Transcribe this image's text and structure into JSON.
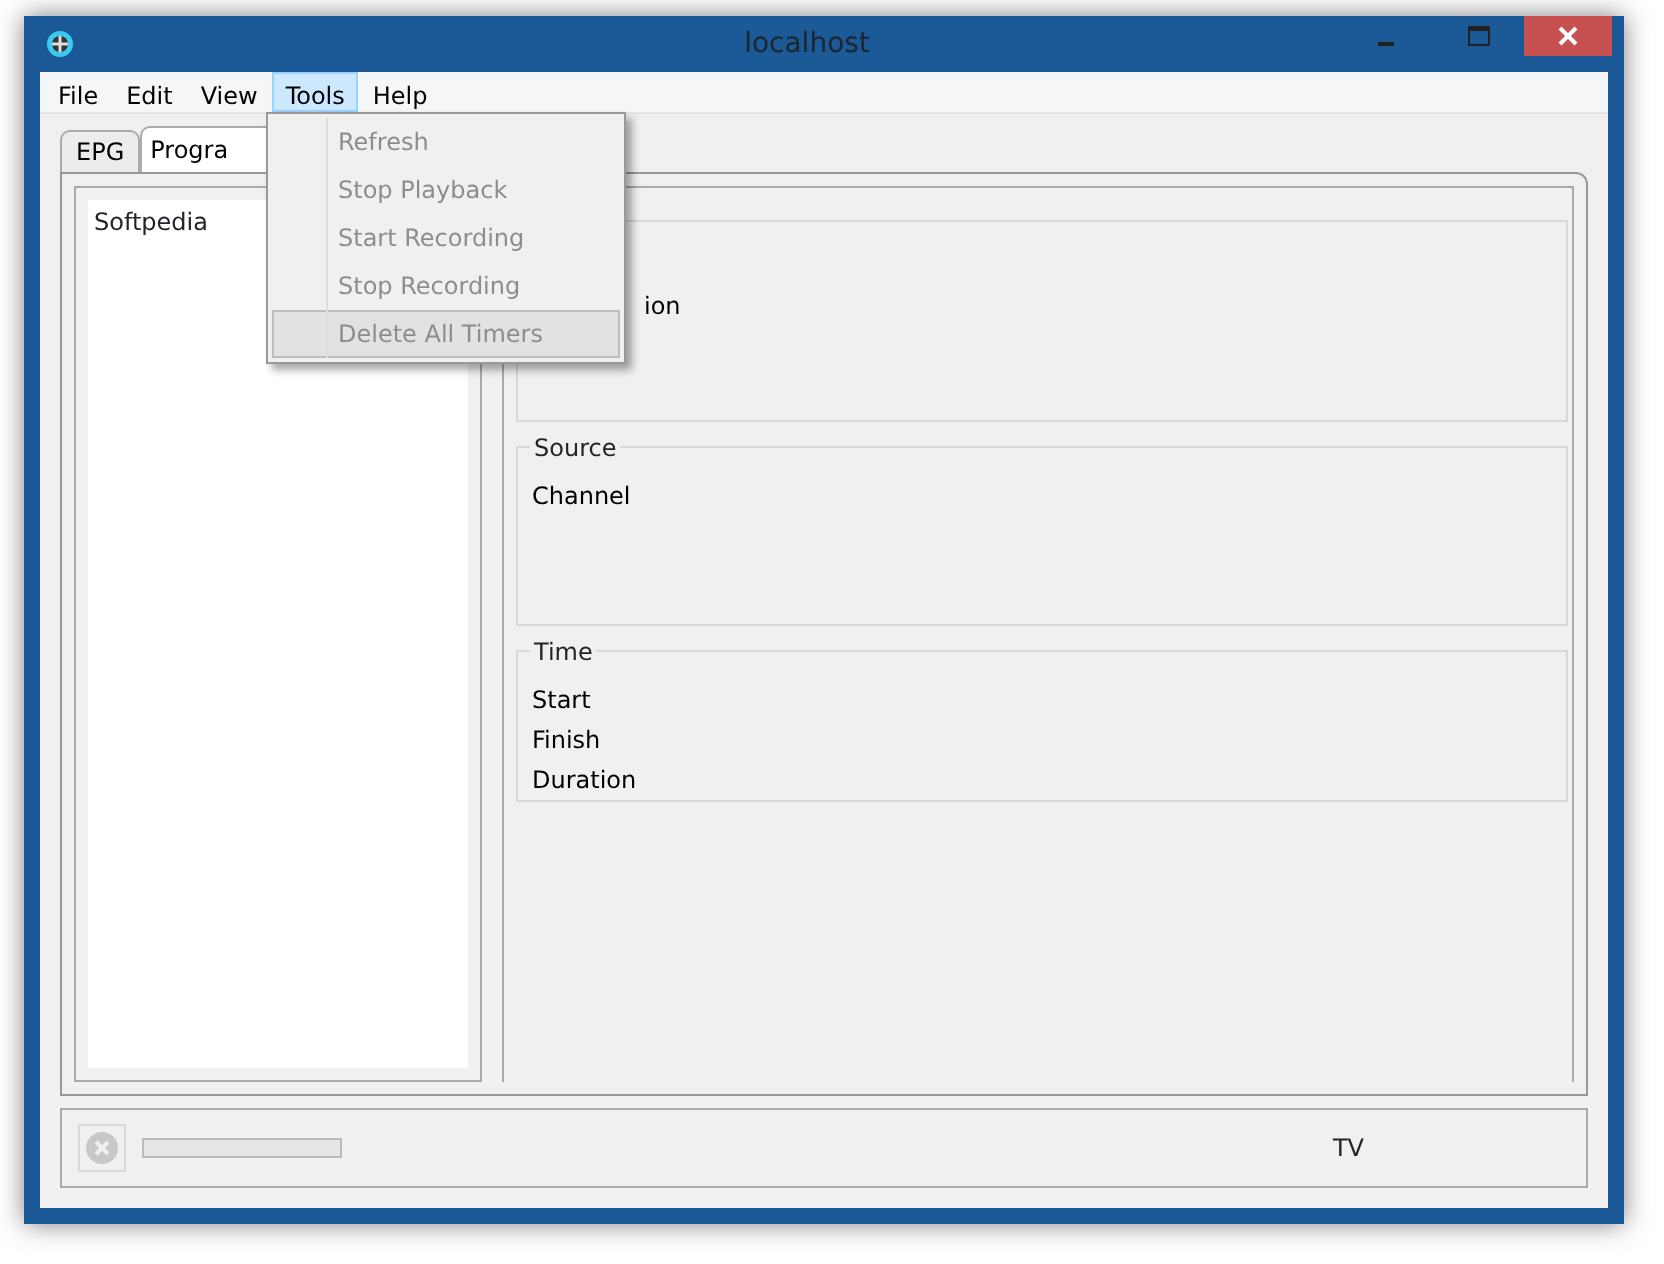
{
  "window": {
    "title": "localhost"
  },
  "menu_bar": [
    {
      "label": "File",
      "selected": false
    },
    {
      "label": "Edit",
      "selected": false
    },
    {
      "label": "View",
      "selected": false
    },
    {
      "label": "Tools",
      "selected": true
    },
    {
      "label": "Help",
      "selected": false
    }
  ],
  "tools_menu": [
    {
      "label": "Refresh",
      "disabled": true,
      "highlighted": false
    },
    {
      "label": "Stop Playback",
      "disabled": true,
      "highlighted": false
    },
    {
      "label": "Start Recording",
      "disabled": true,
      "highlighted": false
    },
    {
      "label": "Stop Recording",
      "disabled": true,
      "highlighted": false
    },
    {
      "label": "Delete All Timers",
      "disabled": true,
      "highlighted": true
    }
  ],
  "tabs": [
    {
      "label": "EPG",
      "selected": false
    },
    {
      "label": "Progra",
      "selected": true
    }
  ],
  "program_list": [
    "Softpedia"
  ],
  "groups": [
    {
      "fields": [
        "ion"
      ]
    },
    {
      "title": "Source",
      "fields": [
        "Channel"
      ]
    },
    {
      "title": "Time",
      "fields": [
        "Start",
        "Finish",
        "Duration"
      ]
    }
  ],
  "status_bar": {
    "text": "TV",
    "level": 0
  }
}
